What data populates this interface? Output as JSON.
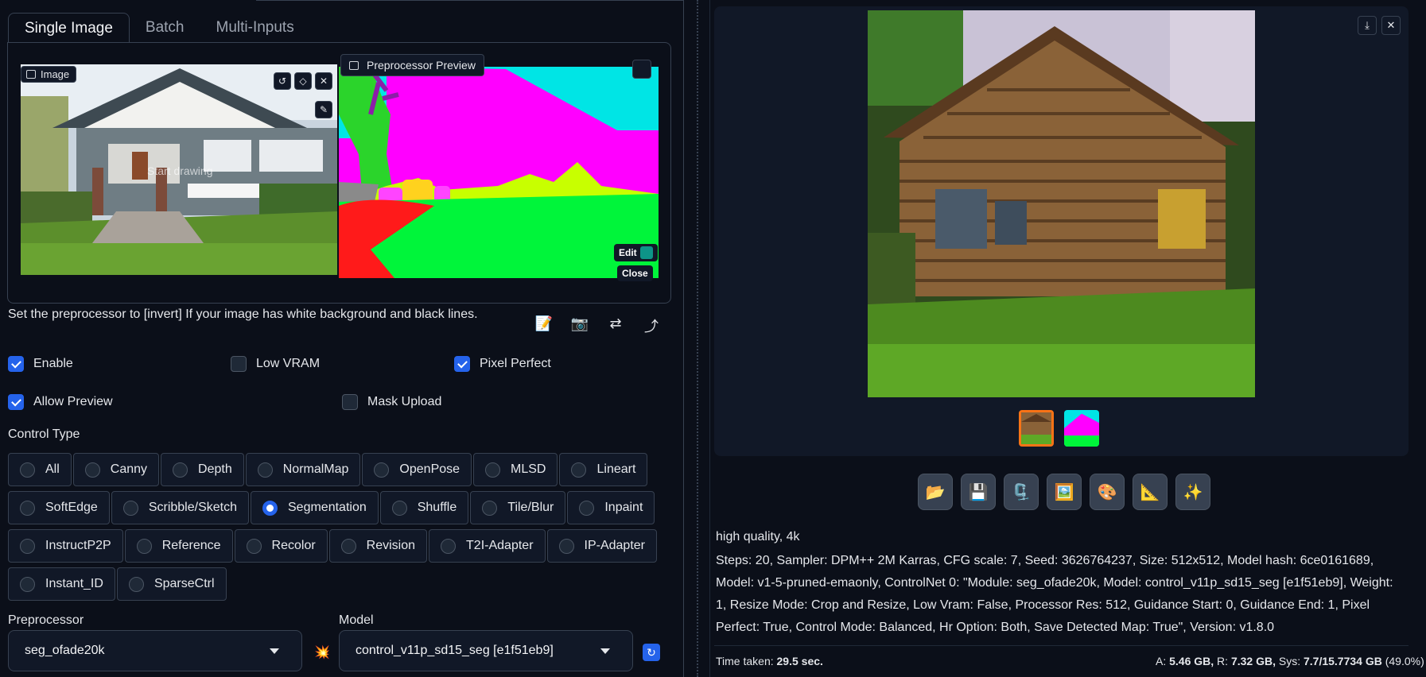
{
  "tabs": [
    "Single Image",
    "Batch",
    "Multi-Inputs"
  ],
  "image_panel": {
    "label": "Image",
    "draw_hint": "Start drawing",
    "buttons": [
      "undo-icon",
      "eraser-icon",
      "close-icon",
      "brush-icon"
    ]
  },
  "preview_panel": {
    "label": "Preprocessor Preview",
    "edit_label": "Edit",
    "close_label": "Close"
  },
  "hint": "Set the preprocessor to [invert] If your image has white background and black lines.",
  "tool_icons": [
    "📝",
    "📷",
    "⇄",
    "⤴"
  ],
  "checkboxes": {
    "enable": {
      "label": "Enable",
      "checked": true
    },
    "low_vram": {
      "label": "Low VRAM",
      "checked": false
    },
    "pixel_perfect": {
      "label": "Pixel Perfect",
      "checked": true
    },
    "allow_preview": {
      "label": "Allow Preview",
      "checked": true
    },
    "mask_upload": {
      "label": "Mask Upload",
      "checked": false
    }
  },
  "control_type": {
    "label": "Control Type",
    "rows": [
      [
        "All",
        "Canny",
        "Depth",
        "NormalMap",
        "OpenPose",
        "MLSD",
        "Lineart"
      ],
      [
        "SoftEdge",
        "Scribble/Sketch",
        "Segmentation",
        "Shuffle",
        "Tile/Blur",
        "Inpaint"
      ],
      [
        "InstructP2P",
        "Reference",
        "Recolor",
        "Revision",
        "T2I-Adapter",
        "IP-Adapter"
      ],
      [
        "Instant_ID",
        "SparseCtrl"
      ]
    ],
    "selected": "Segmentation"
  },
  "preprocessor": {
    "label": "Preprocessor",
    "value": "seg_ofade20k",
    "icon": "💥"
  },
  "model": {
    "label": "Model",
    "value": "control_v11p_sd15_seg [e1f51eb9]",
    "icon": "🔄"
  },
  "output": {
    "action_icons": [
      "📂",
      "💾",
      "🗜️",
      "🖼️",
      "🎨",
      "📐",
      "✨"
    ],
    "prompt": "high quality, 4k",
    "params": "Steps: 20, Sampler: DPM++ 2M Karras, CFG scale: 7, Seed: 3626764237, Size: 512x512, Model hash: 6ce0161689, Model: v1-5-pruned-emaonly, ControlNet 0: \"Module: seg_ofade20k, Model: control_v11p_sd15_seg [e1f51eb9], Weight: 1, Resize Mode: Crop and Resize, Low Vram: False, Processor Res: 512, Guidance Start: 0, Guidance End: 1, Pixel Perfect: True, Control Mode: Balanced, Hr Option: Both, Save Detected Map: True\", Version: v1.8.0",
    "time_label": "Time taken:",
    "time_value": "29.5 sec.",
    "mem_a_label": "A:",
    "mem_a": "5.46 GB,",
    "mem_r_label": "R:",
    "mem_r": "7.32 GB,",
    "mem_sys_label": "Sys:",
    "mem_sys": "7.7/15.7734 GB",
    "mem_pct": "(49.0%)"
  }
}
